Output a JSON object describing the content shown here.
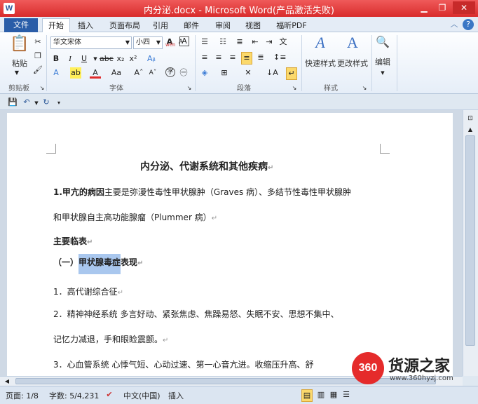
{
  "window": {
    "title": "内分泌.docx - Microsoft Word(产品激活失败)",
    "app_icon": "W"
  },
  "tabs": {
    "file": "文件",
    "items": [
      "开始",
      "插入",
      "页面布局",
      "引用",
      "邮件",
      "审阅",
      "视图",
      "福昕PDF"
    ],
    "active": "开始"
  },
  "ribbon": {
    "clipboard": {
      "paste": "粘贴",
      "label": "剪贴板"
    },
    "font": {
      "name": "华文宋体",
      "size": "小四",
      "label": "字体",
      "wen": "wén"
    },
    "paragraph": {
      "label": "段落"
    },
    "styles": {
      "quick": "快速样式",
      "change": "更改样式",
      "label": "样式"
    },
    "editing": {
      "label": "编辑"
    }
  },
  "document": {
    "title": "内分泌、代谢系统和其他疾病",
    "p1_bold": "1.甲亢的病因",
    "p1_rest": "主要是弥漫性毒性甲状腺肿（Graves 病）、多结节性毒性甲状腺肿",
    "p1_line2": "和甲状腺自主高功能腺瘤（Plummer 病）",
    "h2": "主要临表",
    "h3_prefix": "（一）",
    "h3_highlight": "甲状腺毒症",
    "h3_suffix": "表现",
    "item1": "1．高代谢综合征",
    "item2": "2．精神神经系统   多言好动、紧张焦虑、焦躁易怒、失眠不安、思想不集中、",
    "item2_line2": "记忆力减退，手和眼睑震颤。",
    "item3": "3．心血管系统   心悸气短、心动过速、第一心音亢进。收缩压升高、舒"
  },
  "status": {
    "page": "页面: 1/8",
    "words": "字数: 5/4,231",
    "lang": "中文(中国)",
    "mode": "插入"
  },
  "watermark": {
    "badge": "360",
    "brand": "货源之家",
    "url": "www.360hyzj.com"
  }
}
